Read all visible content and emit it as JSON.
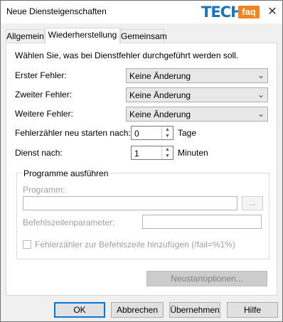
{
  "window": {
    "title": "Neue Diensteigenschaften",
    "close_glyph": "✕"
  },
  "logo": {
    "part1": "TECH",
    "part2": "faq"
  },
  "tabs": [
    {
      "label": "Allgemein",
      "active": false
    },
    {
      "label": "Wiederherstellung",
      "active": true
    },
    {
      "label": "Gemeinsam",
      "active": false
    }
  ],
  "recovery": {
    "intro": "Wählen Sie, was bei Dienstfehler durchgeführt werden soll.",
    "first_failure": {
      "label": "Erster Fehler:",
      "value": "Keine Änderung"
    },
    "second_failure": {
      "label": "Zweiter Fehler:",
      "value": "Keine Änderung"
    },
    "subsequent_failures": {
      "label": "Weitere Fehler:",
      "value": "Keine Änderung"
    },
    "reset_counter": {
      "label": "Fehlerzähler neu starten nach:",
      "value": "0",
      "unit": "Tage"
    },
    "restart_service": {
      "label": "Dienst nach:",
      "value": "1",
      "unit": "Minuten"
    }
  },
  "run_program": {
    "group_title": "Programme ausführen",
    "program_label": "Programm:",
    "program_value": "",
    "browse_label": "...",
    "params_label": "Befehlszeilenparameter:",
    "params_value": "",
    "append_checkbox_label": "Fehlerzähler zur Befehlszeile hinzufügen (/fail=%1%)",
    "append_checked": false
  },
  "restart_options_label": "Neustartoptionen...",
  "footer": {
    "ok": "OK",
    "cancel": "Abbrechen",
    "apply": "Übernehmen",
    "help": "Hilfe"
  },
  "colors": {
    "accent": "#0078d7",
    "logo_blue": "#1c73b8",
    "logo_orange": "#f5821f"
  },
  "icons": {
    "dropdown": "chevron-down-icon",
    "spin_up": "arrow-up-icon",
    "spin_down": "arrow-down-icon",
    "close": "close-icon"
  }
}
